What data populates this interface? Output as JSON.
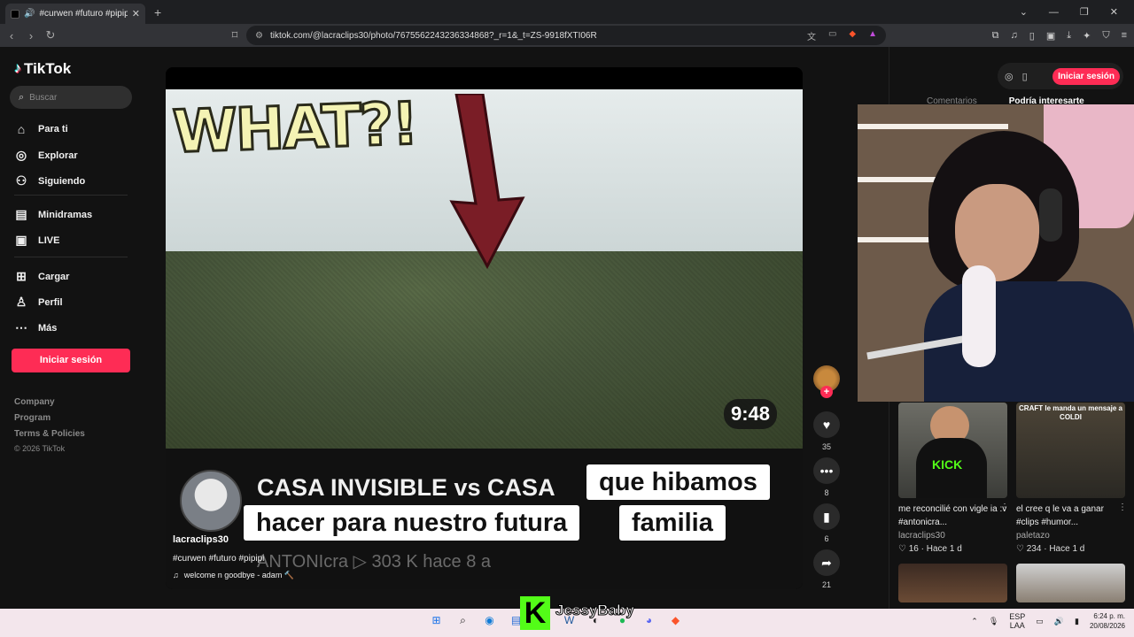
{
  "browser": {
    "tab_title": "#curwen #futuro #pipipi | pipi",
    "url": "tiktok.com/@lacraclips30/photo/7675562243236334868?_r=1&_t=ZS-9918fXTI06R"
  },
  "sidebar": {
    "logo": "TikTok",
    "search_placeholder": "Buscar",
    "items": [
      {
        "label": "Para ti",
        "icon": "home-icon"
      },
      {
        "label": "Explorar",
        "icon": "compass-icon"
      },
      {
        "label": "Siguiendo",
        "icon": "following-icon"
      },
      {
        "label": "Minidramas",
        "icon": "minidramas-icon"
      },
      {
        "label": "LIVE",
        "icon": "live-icon"
      },
      {
        "label": "Cargar",
        "icon": "upload-icon"
      },
      {
        "label": "Perfil",
        "icon": "profile-icon"
      },
      {
        "label": "Más",
        "icon": "more-icon"
      }
    ],
    "login_label": "Iniciar sesión",
    "footer": [
      "Company",
      "Program",
      "Terms & Policies",
      "© 2026 TikTok"
    ]
  },
  "video": {
    "overlay_text": "WHAT?!",
    "duration": "9:48",
    "video_title": "CASA INVISIBLE vs CASA",
    "caption_line1": "que hibamos",
    "caption_line2a": "hacer para nuestro futura",
    "caption_line2b": "familia",
    "stats": "ANTONIcra   ▷ 303 K   hace 8 a",
    "author": "lacraclips30",
    "hashtags": "#curwen #futuro #pipipi",
    "music": "welcome n goodbye - adam 🔨"
  },
  "actions": {
    "likes": "35",
    "comments": "8",
    "saves": "6",
    "shares": "21"
  },
  "right_panel": {
    "login_label": "Iniciar sesión",
    "tabs": [
      "Comentarios",
      "Podría interesarte"
    ],
    "cards": [
      {
        "title": "me reconcilié con vigle ia :v #antonicra...",
        "author": "lacraclips30",
        "meta": "♡ 16 · Hace 1 d",
        "thumb_text": "KICK"
      },
      {
        "title": "el cree q le va a ganar #clips #humor...",
        "author": "paletazo",
        "meta": "♡ 234 · Hace 1 d",
        "thumb_text": "CRAFT le manda un mensaje a COLDI"
      }
    ]
  },
  "stream_overlay": {
    "kick_logo": "K",
    "streamer": "JessyBaby"
  },
  "taskbar": {
    "lang_line1": "ESP",
    "lang_line2": "LAA",
    "time": "6:24 p. m.",
    "date": "20/08/2026"
  }
}
